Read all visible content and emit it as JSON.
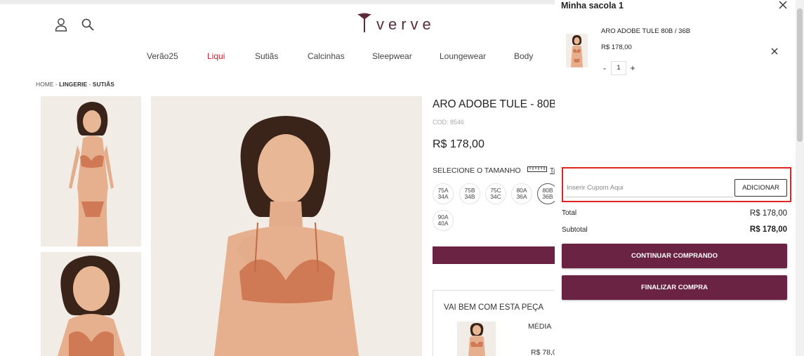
{
  "header": {
    "user_icon": "user-icon",
    "search_icon": "search-icon",
    "brand": "verve"
  },
  "nav": {
    "items": [
      {
        "label": "Verão25"
      },
      {
        "label": "Liqui",
        "highlight": true
      },
      {
        "label": "Sutiãs"
      },
      {
        "label": "Calcinhas"
      },
      {
        "label": "Sleepwear"
      },
      {
        "label": "Loungewear"
      },
      {
        "label": "Body"
      }
    ]
  },
  "breadcrumb": {
    "home": "HOME",
    "sep": " - ",
    "cat1": "LINGERIE",
    "cat2": "SUTIÃS"
  },
  "product": {
    "title": "ARO ADOBE TULE - 80B /",
    "code": "COD: 8546",
    "price": "R$ 178,00",
    "size_label": "SELECIONE O TAMANHO",
    "size_guide": "Ta",
    "sizes": [
      {
        "top": "75A",
        "bottom": "34A"
      },
      {
        "top": "75B",
        "bottom": "34B"
      },
      {
        "top": "75C",
        "bottom": "34C"
      },
      {
        "top": "80A",
        "bottom": "36A"
      },
      {
        "top": "80B",
        "bottom": "36B",
        "selected": true
      },
      {
        "top": "90A",
        "bottom": "40A"
      }
    ]
  },
  "suggest": {
    "title": "VAI BEM COM ESTA PEÇA",
    "name": "MÉDIA",
    "price": "R$ 78,0"
  },
  "cart": {
    "title": "Minha sacola 1",
    "item_name": "ARO ADOBE TULE 80B / 36B",
    "item_price": "R$ 178,00",
    "qty_minus": "-",
    "qty": "1",
    "qty_plus": "+",
    "coupon_placeholder": "Inserir Cupom Aqui",
    "coupon_button": "ADICIONAR",
    "total_label": "Total",
    "total_value": "R$ 178,00",
    "subtotal_label": "Subtotal",
    "subtotal_value": "R$ 178,00",
    "continue_button": "CONTINUAR COMPRANDO",
    "checkout_button": "FINALIZAR COMPRA"
  },
  "colors": {
    "brand": "#6b2344",
    "highlight_nav": "#d01f2f",
    "coupon_outline": "#e02424"
  }
}
